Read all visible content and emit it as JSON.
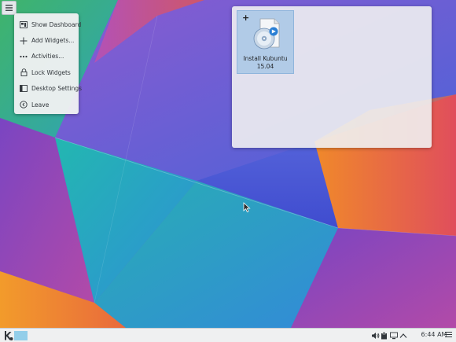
{
  "desktop_menu": {
    "items": [
      {
        "label": "Show Dashboard",
        "icon": "dashboard-icon"
      },
      {
        "label": "Add Widgets...",
        "icon": "plus-icon"
      },
      {
        "label": "Activities...",
        "icon": "activities-icon"
      },
      {
        "label": "Lock Widgets",
        "icon": "lock-icon"
      },
      {
        "label": "Desktop Settings",
        "icon": "settings-icon"
      },
      {
        "label": "Leave",
        "icon": "leave-icon"
      }
    ]
  },
  "folder_view": {
    "item": {
      "line1": "Install Kubuntu",
      "line2": "15.04",
      "icon": "installer-disc-icon"
    }
  },
  "panel": {
    "clock": "6:44 AM",
    "tray_icons": [
      "volume-icon",
      "clipboard-icon",
      "display-icon",
      "expand-tray-icon"
    ]
  },
  "colors": {
    "panel_bg": "#eff0f1",
    "selection": "#a0c3e4",
    "task_accent": "#93cee9"
  }
}
